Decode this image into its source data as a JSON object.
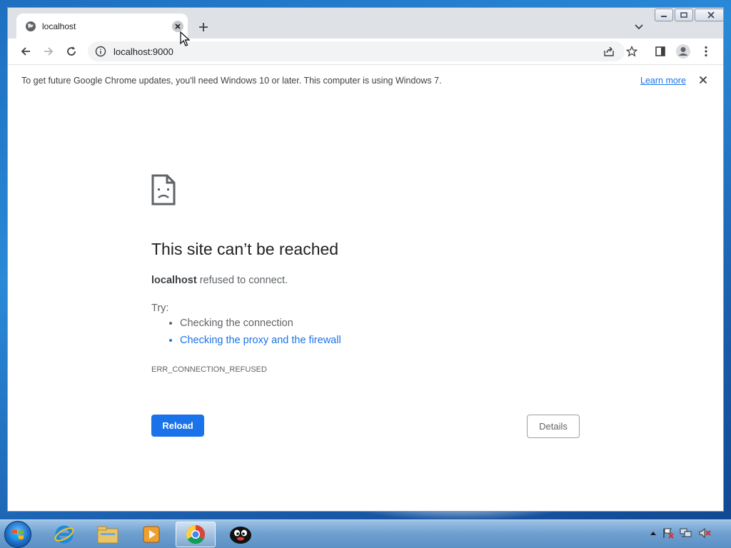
{
  "browser": {
    "tab": {
      "title": "localhost",
      "favicon": "globe-icon",
      "close_icon": "close-icon"
    },
    "new_tab_icon": "plus-icon",
    "tab_search_icon": "chevron-down-icon",
    "window_controls": [
      "minimize-icon",
      "restore-icon",
      "close-icon"
    ],
    "toolbar": {
      "back_icon": "back-arrow-icon",
      "forward_icon": "forward-arrow-icon",
      "reload_icon": "reload-icon",
      "site_info_icon": "info-icon",
      "url": "localhost:9000",
      "share_icon": "share-icon",
      "bookmark_icon": "star-icon",
      "side_panel_icon": "side-panel-icon",
      "profile_icon": "profile-icon",
      "menu_icon": "kebab-menu-icon"
    },
    "infobar": {
      "message": "To get future Google Chrome updates, you'll need Windows 10 or later. This computer is using Windows 7.",
      "link": "Learn more",
      "close_icon": "close-icon"
    }
  },
  "error_page": {
    "icon": "sad-page-icon",
    "title": "This site can’t be reached",
    "host": "localhost",
    "description": "refused to connect.",
    "try_label": "Try:",
    "suggestions": [
      {
        "text": "Checking the connection",
        "is_link": false
      },
      {
        "text": "Checking the proxy and the firewall",
        "is_link": true
      }
    ],
    "error_code": "ERR_CONNECTION_REFUSED",
    "reload_button": "Reload",
    "details_button": "Details",
    "link_color": "#1a73e8"
  },
  "taskbar": {
    "start_icon": "windows-start-icon",
    "apps": [
      "internet-explorer-icon",
      "file-explorer-icon",
      "media-player-icon",
      "chrome-icon",
      "penguin-app-icon"
    ],
    "active_app": "chrome-icon",
    "tray_icons": [
      "show-hidden-icons-arrow",
      "action-center-flag-icon",
      "network-icon",
      "volume-muted-icon"
    ]
  }
}
